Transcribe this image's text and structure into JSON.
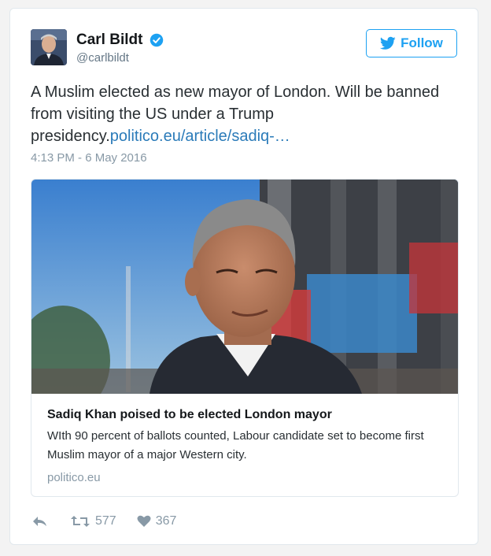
{
  "tweet": {
    "author": {
      "display_name": "Carl Bildt",
      "handle": "@carlbildt",
      "verified": true,
      "avatar_icon": "user-avatar"
    },
    "follow_label": "Follow",
    "text": "A Muslim elected as new mayor of London. Will be banned from visiting the US under a Trump presidency.",
    "link_text": "politico.eu/article/sadiq-…",
    "timestamp": "4:13 PM - 6 May 2016",
    "card": {
      "title": "Sadiq Khan poised to be elected London mayor",
      "description": "WIth 90 percent of ballots counted, Labour candidate set to become first Muslim mayor of a major Western city.",
      "domain": "politico.eu"
    },
    "actions": {
      "reply_icon": "reply-icon",
      "retweet_count": "577",
      "like_count": "367"
    }
  },
  "colors": {
    "accent": "#1da1f2",
    "link": "#2b7bb9",
    "muted": "#8899a6",
    "border": "#e1e8ed"
  }
}
